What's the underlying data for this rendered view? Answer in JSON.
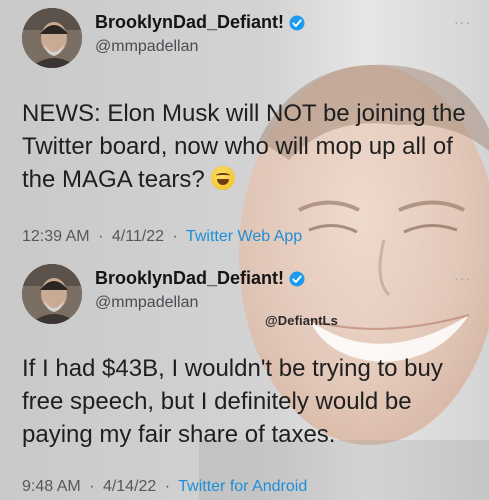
{
  "tweets": [
    {
      "display_name": "BrooklynDad_Defiant!",
      "handle": "@mmpadellan",
      "text": "NEWS: Elon Musk will NOT be joining the Twitter board, now who will mop up all of the MAGA tears?",
      "emoji": "grinning-sweat-emoji",
      "time": "12:39 AM",
      "date": "4/11/22",
      "source": "Twitter Web App"
    },
    {
      "display_name": "BrooklynDad_Defiant!",
      "handle": "@mmpadellan",
      "text": "If I had $43B, I wouldn't be trying to buy free speech, but I definitely would be paying my fair share of taxes.",
      "time": "9:48 AM",
      "date": "4/14/22",
      "source": "Twitter for Android"
    }
  ],
  "watermark": "@DefiantLs",
  "more_label": "···",
  "separator": "·",
  "colors": {
    "link": "#1d8fd8",
    "verified": "#1d9bf0"
  }
}
